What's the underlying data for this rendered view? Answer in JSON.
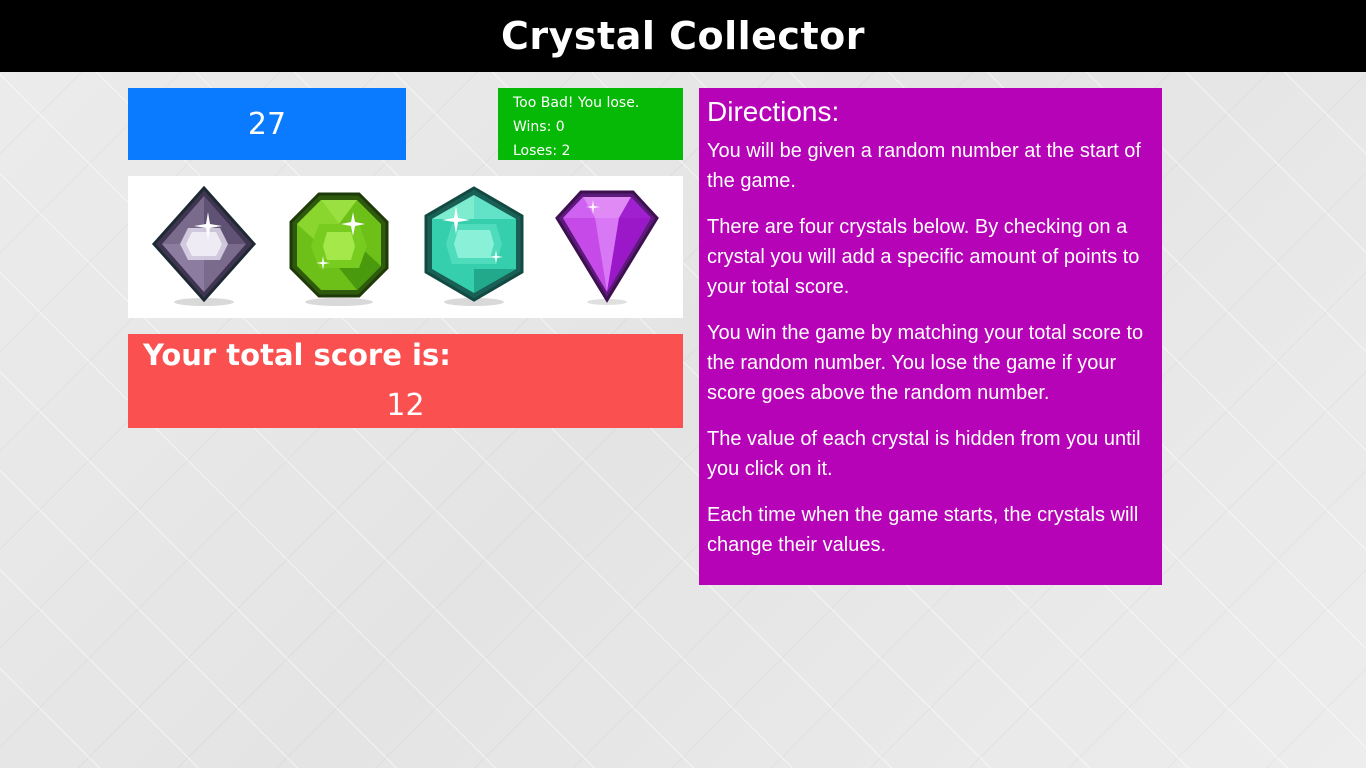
{
  "header": {
    "title": "Crystal Collector"
  },
  "game": {
    "target_number": "27",
    "status_message": "Too Bad! You lose.",
    "wins_text": "Wins: 0",
    "loses_text": "Loses: 2",
    "score_label": "Your total score is:",
    "score_value": "12"
  },
  "crystals": [
    {
      "name": "purple-diamond-crystal",
      "color": "#6b5a7e"
    },
    {
      "name": "green-octagon-crystal",
      "color": "#6cc018"
    },
    {
      "name": "teal-hexagon-crystal",
      "color": "#35cfae"
    },
    {
      "name": "violet-gem-crystal",
      "color": "#b52fe0"
    }
  ],
  "directions": {
    "title": "Directions:",
    "paragraphs": [
      "You will be given a random number at the start of the game.",
      "There are four crystals below. By checking on a crystal you will add a specific amount of points to your total score.",
      "You win the game by matching your total score to the random number. You lose the game if your score goes above the random number.",
      "The value of each crystal is hidden from you until you click on it.",
      "Each time when the game starts, the crystals will change their values."
    ]
  },
  "colors": {
    "header_bg": "#000000",
    "target_bg": "#0a7bff",
    "status_bg": "#07b907",
    "score_bg": "#fa5050",
    "directions_bg": "#b703b7"
  }
}
